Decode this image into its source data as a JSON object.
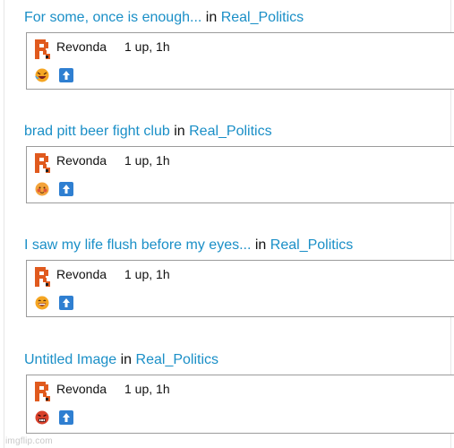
{
  "posts": [
    {
      "title": "For some, once is enough...",
      "in_word": "in",
      "stream": "Real_Politics",
      "username": "Revonda",
      "meta": "1 up, 1h",
      "reaction_icon": "laughing-emoji-icon"
    },
    {
      "title": "brad pitt beer fight club",
      "in_word": "in",
      "stream": "Real_Politics",
      "username": "Revonda",
      "meta": "1 up, 1h",
      "reaction_icon": "blushing-emoji-icon"
    },
    {
      "title": "I saw my life flush before my eyes...",
      "in_word": "in",
      "stream": "Real_Politics",
      "username": "Revonda",
      "meta": "1 up, 1h",
      "reaction_icon": "grinning-emoji-icon"
    },
    {
      "title": "Untitled Image",
      "in_word": "in",
      "stream": "Real_Politics",
      "username": "Revonda",
      "meta": "1 up, 1h",
      "reaction_icon": "angry-emoji-icon"
    }
  ],
  "watermark": "imgflip.com",
  "colors": {
    "link": "#1a8fc7",
    "border": "#9b9b9b",
    "upvote": "#2f7fd1",
    "avatar": "#e05a1e"
  }
}
